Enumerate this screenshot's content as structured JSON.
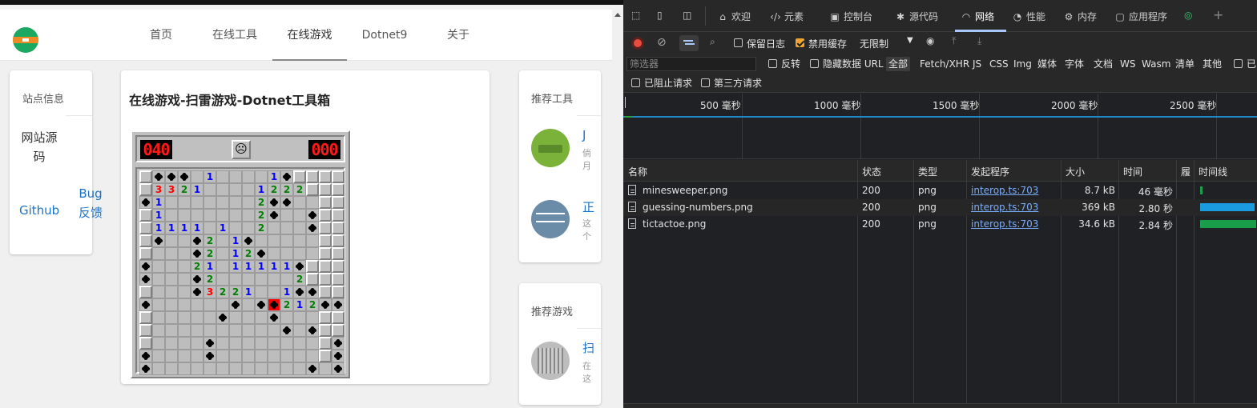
{
  "nav": {
    "items": [
      "首页",
      "在线工具",
      "在线游戏",
      "Dotnet9",
      "关于"
    ],
    "active_index": 2
  },
  "site_info": {
    "title": "站点信息",
    "source_link": "网站源码",
    "github_link": "Github",
    "bug_link": "Bug反馈"
  },
  "game": {
    "title": "在线游戏-扫雷游戏-Dotnet工具箱",
    "mines_counter": "040",
    "timer": "000",
    "face": "☹"
  },
  "recommend_tools": {
    "title": "推荐工具",
    "items": [
      {
        "title_fragment": "J",
        "desc_fragment": "倘 月"
      },
      {
        "title_fragment": "正",
        "desc_fragment": "这 个"
      }
    ]
  },
  "recommend_games": {
    "title": "推荐游戏",
    "items": [
      {
        "title_fragment": "扫",
        "desc_fragment": "在 这"
      }
    ]
  },
  "devtools": {
    "tabs": [
      {
        "icon": "welcome-icon",
        "label": "欢迎"
      },
      {
        "icon": "elements-icon",
        "label": "元素"
      },
      {
        "icon": "console-icon",
        "label": "控制台"
      },
      {
        "icon": "sources-icon",
        "label": "源代码"
      },
      {
        "icon": "network-icon",
        "label": "网络"
      },
      {
        "icon": "performance-icon",
        "label": "性能"
      },
      {
        "icon": "memory-icon",
        "label": "内存"
      },
      {
        "icon": "application-icon",
        "label": "应用程序"
      }
    ],
    "active_tab": "网络",
    "toolbar": {
      "preserve_log": "保留日志",
      "disable_cache": "禁用缓存",
      "throttle": "无限制"
    },
    "filter": {
      "placeholder": "筛选器",
      "invert": "反转",
      "hide_data_urls": "隐藏数据 URL",
      "types": [
        "全部",
        "Fetch/XHR",
        "JS",
        "CSS",
        "Img",
        "媒体",
        "字体",
        "文档",
        "WS",
        "Wasm",
        "清单",
        "其他"
      ],
      "active_type": "全部",
      "blocked_requests": "已阻止请求",
      "third_party": "第三方请求",
      "trailing_fragment": "已"
    },
    "timeline_ticks": [
      "500 毫秒",
      "1000 毫秒",
      "1500 毫秒",
      "2000 毫秒",
      "2500 毫秒"
    ],
    "columns": [
      "名称",
      "状态",
      "类型",
      "发起程序",
      "大小",
      "时间",
      "履",
      "时间线"
    ],
    "rows": [
      {
        "name": "minesweeper.png",
        "status": "200",
        "type": "png",
        "initiator": "interop.ts:703",
        "size": "8.7 kB",
        "time": "46 毫秒",
        "waterfall": 0.01
      },
      {
        "name": "guessing-numbers.png",
        "status": "200",
        "type": "png",
        "initiator": "interop.ts:703",
        "size": "369 kB",
        "time": "2.80 秒",
        "waterfall": 0.95
      },
      {
        "name": "tictactoe.png",
        "status": "200",
        "type": "png",
        "initiator": "interop.ts:703",
        "size": "34.6 kB",
        "time": "2.84 秒",
        "waterfall": 0.97
      }
    ],
    "colors": {
      "accent": "#a8c7fa",
      "link": "#7cacf8",
      "waterfall_blue": "#1a9be0",
      "waterfall_green": "#1a9d4a",
      "checkbox": "#f0a531"
    }
  }
}
